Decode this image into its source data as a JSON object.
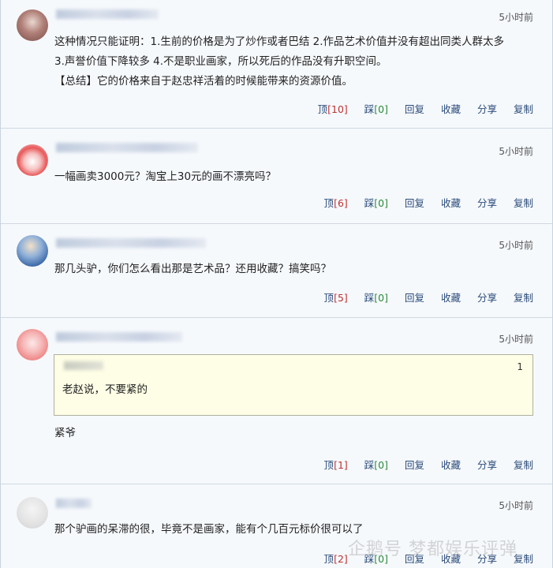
{
  "actions": {
    "top": "顶",
    "down": "踩",
    "reply": "回复",
    "fav": "收藏",
    "share": "分享",
    "copy": "复制"
  },
  "comments": [
    {
      "time": "5小时前",
      "lines": [
        "这种情况只能证明：1.生前的价格是为了炒作或者巴结 2.作品艺术价值并没有超出同类人群太多",
        "3.声誉价值下降较多 4.不是职业画家，所以死后的作品没有升职空间。",
        "【总结】它的价格来自于赵忠祥活着的时候能带来的资源价值。"
      ],
      "up": "[10]",
      "down": "[0]"
    },
    {
      "time": "5小时前",
      "lines": [
        "一幅画卖3000元？淘宝上30元的画不漂亮吗？"
      ],
      "up": "[6]",
      "down": "[0]"
    },
    {
      "time": "5小时前",
      "lines": [
        "那几头驴，你们怎么看出那是艺术品？还用收藏？搞笑吗？"
      ],
      "up": "[5]",
      "down": "[0]"
    },
    {
      "time": "5小时前",
      "quote": {
        "num": "1",
        "text": "老赵说，不要紧的"
      },
      "lines": [
        "紧爷"
      ],
      "up": "[1]",
      "down": "[0]"
    },
    {
      "time": "5小时前",
      "lines": [
        "那个驴画的呆滞的很，毕竟不是画家，能有个几百元标价很可以了"
      ],
      "up": "[2]",
      "down": "[0]"
    }
  ],
  "watermark": "企鹅号 梦都娱乐评弹"
}
